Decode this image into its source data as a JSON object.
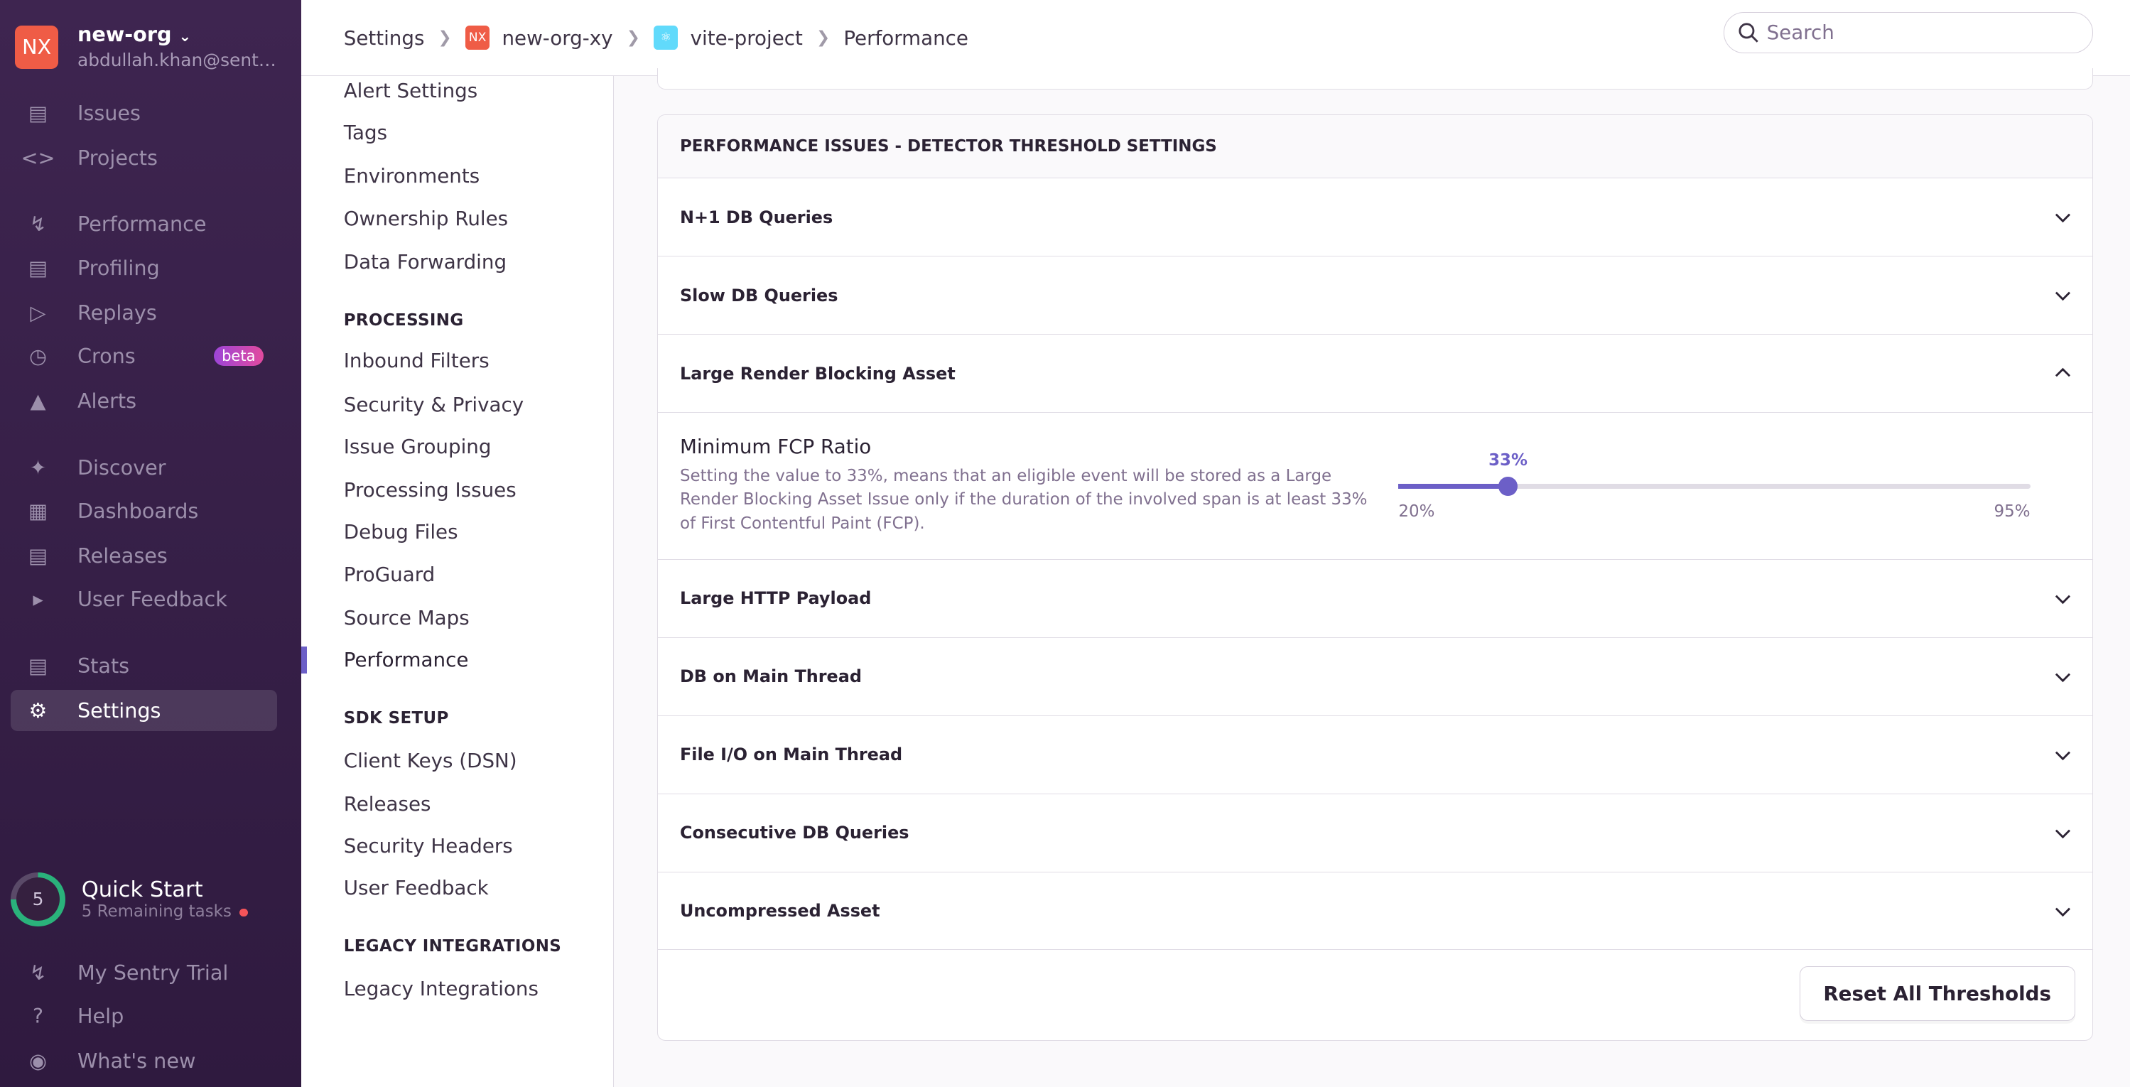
{
  "org": {
    "initials": "NX",
    "name": "new-org",
    "user": "abdullah.khan@sentry.io"
  },
  "nav": [
    {
      "label": "Issues",
      "icon": "inbox-icon"
    },
    {
      "label": "Projects",
      "icon": "folder-code-icon"
    },
    {
      "label": "Performance",
      "icon": "lightning-icon"
    },
    {
      "label": "Profiling",
      "icon": "profiling-icon"
    },
    {
      "label": "Replays",
      "icon": "play-icon"
    },
    {
      "label": "Crons",
      "icon": "clock-icon",
      "badge": "beta"
    },
    {
      "label": "Alerts",
      "icon": "siren-icon"
    },
    {
      "label": "Discover",
      "icon": "telescope-icon"
    },
    {
      "label": "Dashboards",
      "icon": "dashboard-icon"
    },
    {
      "label": "Releases",
      "icon": "stack-icon"
    },
    {
      "label": "User Feedback",
      "icon": "megaphone-icon"
    },
    {
      "label": "Stats",
      "icon": "bar-chart-icon"
    },
    {
      "label": "Settings",
      "icon": "gear-icon"
    }
  ],
  "quick_start": {
    "count": "5",
    "title": "Quick Start",
    "subtitle": "5 Remaining tasks"
  },
  "footer_nav": [
    {
      "label": "My Sentry Trial",
      "icon": "lightning-circle-icon"
    },
    {
      "label": "Help",
      "icon": "question-icon"
    },
    {
      "label": "What's new",
      "icon": "broadcast-icon"
    }
  ],
  "breadcrumb": {
    "settings": "Settings",
    "org": "new-org-xy",
    "org_initials": "NX",
    "project": "vite-project",
    "page": "Performance"
  },
  "search": {
    "placeholder": "Search"
  },
  "subnav": {
    "top_items": [
      "Alert Settings",
      "Tags",
      "Environments",
      "Ownership Rules",
      "Data Forwarding"
    ],
    "processing_header": "PROCESSING",
    "processing": [
      "Inbound Filters",
      "Security & Privacy",
      "Issue Grouping",
      "Processing Issues",
      "Debug Files",
      "ProGuard",
      "Source Maps",
      "Performance"
    ],
    "sdk_header": "SDK SETUP",
    "sdk": [
      "Client Keys (DSN)",
      "Releases",
      "Security Headers",
      "User Feedback"
    ],
    "legacy_header": "LEGACY INTEGRATIONS",
    "legacy": [
      "Legacy Integrations"
    ]
  },
  "panel": {
    "title": "PERFORMANCE ISSUES - DETECTOR THRESHOLD SETTINGS",
    "rows": [
      "N+1 DB Queries",
      "Slow DB Queries",
      "Large Render Blocking Asset",
      "Large HTTP Payload",
      "DB on Main Thread",
      "File I/O on Main Thread",
      "Consecutive DB Queries",
      "Uncompressed Asset"
    ],
    "field": {
      "label": "Minimum FCP Ratio",
      "help": "Setting the value to 33%, means that an eligible event will be stored as a Large Render Blocking Asset Issue only if the duration of the involved span is at least 33% of First Contentful Paint (FCP).",
      "value": 33,
      "value_label": "33%",
      "min": 20,
      "max": 95,
      "min_label": "20%",
      "max_label": "95%"
    },
    "reset_label": "Reset All Thresholds"
  },
  "colors": {
    "accent": "#6c5fc7",
    "sidebar": "#3e2550",
    "org_avatar": "#ef5c46"
  }
}
